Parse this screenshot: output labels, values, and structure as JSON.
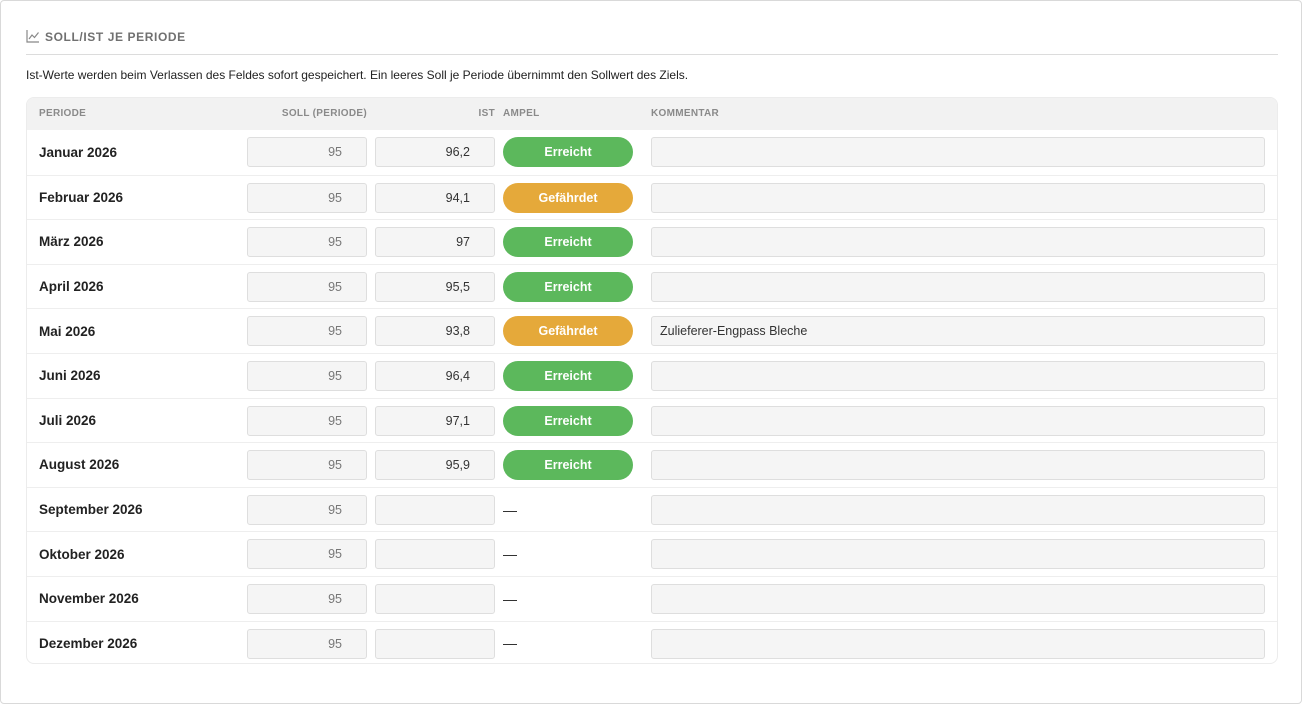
{
  "section": {
    "title": "SOLL/IST JE PERIODE",
    "icon": "line-chart-icon",
    "hint": "Ist-Werte werden beim Verlassen des Feldes sofort gespeichert. Ein leeres Soll je Periode übernimmt den Sollwert des Ziels."
  },
  "colors": {
    "erreicht": "#5cb85c",
    "gefaehrdet": "#e5a93a"
  },
  "table": {
    "headers": {
      "periode": "PERIODE",
      "soll": "SOLL (PERIODE)",
      "ist": "IST",
      "ampel": "AMPEL",
      "kommentar": "KOMMENTAR"
    },
    "rows": [
      {
        "periode": "Januar 2026",
        "soll": "95",
        "ist": "96,2",
        "ampel": "Erreicht",
        "status": "erreicht",
        "kommentar": ""
      },
      {
        "periode": "Februar 2026",
        "soll": "95",
        "ist": "94,1",
        "ampel": "Gefährdet",
        "status": "gefaehrdet",
        "kommentar": ""
      },
      {
        "periode": "März 2026",
        "soll": "95",
        "ist": "97",
        "ampel": "Erreicht",
        "status": "erreicht",
        "kommentar": ""
      },
      {
        "periode": "April 2026",
        "soll": "95",
        "ist": "95,5",
        "ampel": "Erreicht",
        "status": "erreicht",
        "kommentar": ""
      },
      {
        "periode": "Mai 2026",
        "soll": "95",
        "ist": "93,8",
        "ampel": "Gefährdet",
        "status": "gefaehrdet",
        "kommentar": "Zulieferer-Engpass Bleche"
      },
      {
        "periode": "Juni 2026",
        "soll": "95",
        "ist": "96,4",
        "ampel": "Erreicht",
        "status": "erreicht",
        "kommentar": ""
      },
      {
        "periode": "Juli 2026",
        "soll": "95",
        "ist": "97,1",
        "ampel": "Erreicht",
        "status": "erreicht",
        "kommentar": ""
      },
      {
        "periode": "August 2026",
        "soll": "95",
        "ist": "95,9",
        "ampel": "Erreicht",
        "status": "erreicht",
        "kommentar": ""
      },
      {
        "periode": "September 2026",
        "soll": "95",
        "ist": "",
        "ampel": "—",
        "status": "none",
        "kommentar": ""
      },
      {
        "periode": "Oktober 2026",
        "soll": "95",
        "ist": "",
        "ampel": "—",
        "status": "none",
        "kommentar": ""
      },
      {
        "periode": "November 2026",
        "soll": "95",
        "ist": "",
        "ampel": "—",
        "status": "none",
        "kommentar": ""
      },
      {
        "periode": "Dezember 2026",
        "soll": "95",
        "ist": "",
        "ampel": "—",
        "status": "none",
        "kommentar": ""
      }
    ]
  }
}
